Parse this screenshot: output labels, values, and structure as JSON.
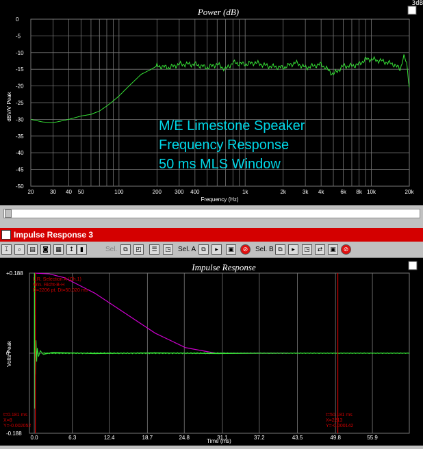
{
  "corner_text": "3dB",
  "top_chart": {
    "title": "Power (dB)",
    "ylabel": "dBV/V Peak",
    "xlabel": "Frequency (Hz)",
    "annotation": [
      "M/E Limestone Speaker",
      "Frequency Response",
      "50 ms MLS Window"
    ],
    "yticks": [
      "0",
      "-5",
      "-10",
      "-15",
      "-20",
      "-25",
      "-30",
      "-35",
      "-40",
      "-45",
      "-50"
    ],
    "xticks": [
      "20",
      "30",
      "40",
      "50",
      "100",
      "200",
      "300",
      "400",
      "1k",
      "2k",
      "3k",
      "4k",
      "6k",
      "8k",
      "10k",
      "20k"
    ],
    "xtick_values": [
      20,
      30,
      40,
      50,
      100,
      200,
      300,
      400,
      1000,
      2000,
      3000,
      4000,
      6000,
      8000,
      10000,
      20000
    ]
  },
  "window": {
    "title": "Impulse Response 3",
    "toolbar_sel_a": "Sel. A",
    "toolbar_sel_b": "Sel. B",
    "toolbar_sel": "Sel."
  },
  "bottom_chart": {
    "title": "Impulse Response",
    "ylabel": "Volts Peak",
    "xlabel": "Time (ms)",
    "yticks": [
      "+0.188",
      "0",
      "-0.188"
    ],
    "xticks": [
      "0.0",
      "6.3",
      "12.4",
      "18.7",
      "24.8",
      "31.1",
      "37.2",
      "43.5",
      "49.8",
      "55.9"
    ],
    "info": [
      "L.R. Selection A (Ch.1)",
      "Win. Richt-B-H",
      "D=2206 pt.  Dt=50.020 ms"
    ],
    "cursor_a": [
      "t=0.181 ms",
      "X=8",
      "Y=-0.002052"
    ],
    "cursor_b": [
      "t=50.181 ms",
      "X=2213",
      "Y=-0.000142"
    ]
  },
  "colors": {
    "trace": "#36e036",
    "window": "#d000d0",
    "annotation": "#00d8e8",
    "cursor": "#d00000",
    "grid": "#7a7a7a"
  },
  "chart_data": [
    {
      "type": "line",
      "title": "Power (dB)",
      "xlabel": "Frequency (Hz)",
      "ylabel": "dBV/V Peak",
      "xscale": "log",
      "xlim": [
        20,
        20000
      ],
      "ylim": [
        -50,
        0
      ],
      "series": [
        {
          "x": [
            20,
            25,
            30,
            40,
            50,
            60,
            70,
            80,
            90,
            100,
            120,
            150,
            180,
            200,
            250,
            300,
            400,
            500,
            600,
            700,
            800,
            1000,
            1200,
            1500,
            2000,
            2500,
            3000,
            4000,
            5000,
            6000,
            7000,
            8000,
            9000,
            10000,
            12000,
            15000,
            17000,
            18000,
            19000,
            20000
          ],
          "y": [
            -30,
            -30.8,
            -31,
            -30,
            -29,
            -28.5,
            -27.5,
            -26,
            -24.5,
            -23,
            -20,
            -16.5,
            -15,
            -14,
            -14.5,
            -13.5,
            -13.5,
            -14.5,
            -13.5,
            -15,
            -13,
            -13.5,
            -13,
            -14,
            -14.5,
            -13,
            -14.5,
            -13.5,
            -16.5,
            -14,
            -14,
            -13.5,
            -12,
            -12,
            -12.5,
            -13.5,
            -15,
            -11,
            -13,
            -20
          ]
        }
      ]
    },
    {
      "type": "line",
      "title": "Impulse Response",
      "xlabel": "Time (ms)",
      "ylabel": "Volts Peak",
      "xlim": [
        -0.8,
        62
      ],
      "ylim": [
        -0.188,
        0.188
      ],
      "series": [
        {
          "x": [
            0.0,
            0.05,
            0.1,
            0.15,
            0.2,
            0.3,
            0.4,
            0.5,
            0.7,
            1.0,
            1.5,
            3.0,
            10.0,
            20.0,
            30.0,
            40.0,
            50.0,
            62.0
          ],
          "y": [
            0,
            0.188,
            -0.13,
            0.09,
            -0.05,
            0.03,
            -0.02,
            0.012,
            -0.008,
            0.006,
            -0.003,
            0.002,
            -0.001,
            0.001,
            -0.001,
            0.0,
            0.0,
            0.0
          ]
        },
        {
          "x": [
            0.0,
            2.5,
            5.0,
            10.0,
            15.0,
            20.0,
            25.0,
            30.0,
            35.0,
            40.0,
            42.0
          ],
          "y": [
            0.188,
            0.186,
            0.177,
            0.141,
            0.094,
            0.047,
            0.013,
            0.0,
            0.0,
            0.0,
            0.0
          ]
        }
      ],
      "cursors_ms": [
        0.181,
        50.181
      ]
    }
  ]
}
